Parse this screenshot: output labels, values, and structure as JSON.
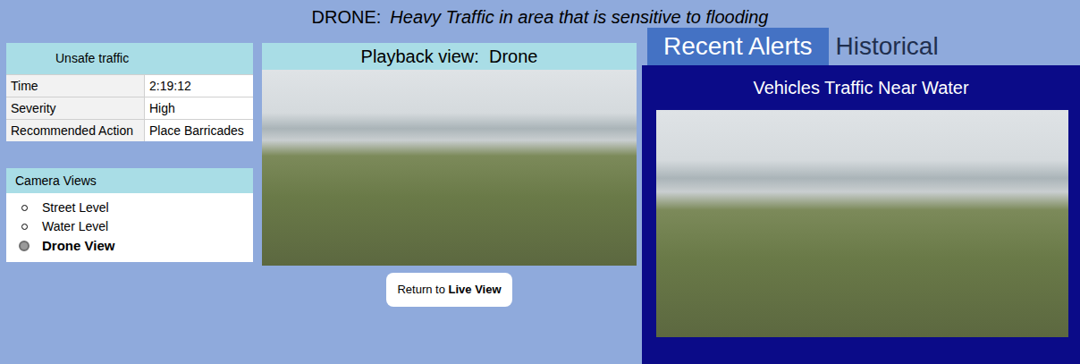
{
  "header": {
    "prefix": "DRONE:",
    "title": "Heavy Traffic in area that is sensitive to flooding"
  },
  "alert_details": {
    "title": "Unsafe traffic",
    "rows": [
      [
        "Time",
        "2:19:12"
      ],
      [
        "Severity",
        "High"
      ],
      [
        "Recommended Action",
        "Place Barricades"
      ]
    ]
  },
  "camera_views": {
    "title": "Camera Views",
    "options": [
      {
        "label": "Street Level",
        "selected": false
      },
      {
        "label": "Water Level",
        "selected": false
      },
      {
        "label": "Drone View",
        "selected": true
      }
    ]
  },
  "playback": {
    "title": "Playback view:  Drone",
    "button": {
      "prefix": "Return to ",
      "emphasis": "Live View"
    }
  },
  "tabs": [
    {
      "label": "Recent Alerts",
      "selected": true
    },
    {
      "label": "Historical",
      "selected": false
    }
  ],
  "alert_panel": {
    "title": "Vehicles Traffic Near Water"
  }
}
